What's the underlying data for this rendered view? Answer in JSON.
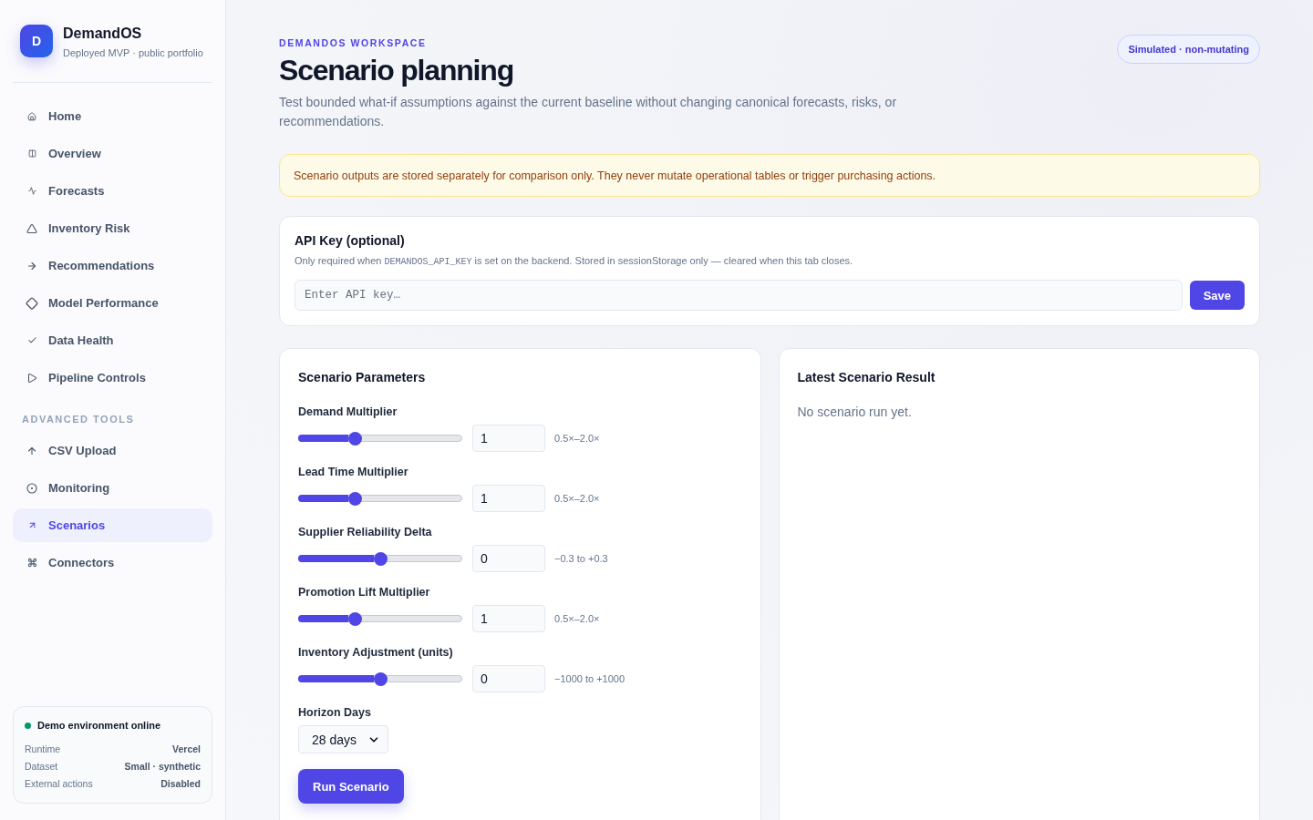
{
  "sidebar": {
    "brand": {
      "logo_letter": "D",
      "name": "DemandOS",
      "tagline": "Deployed MVP · public portfolio"
    },
    "nav_groups": [
      {
        "items": [
          {
            "label": "Home",
            "selected": false
          },
          {
            "label": "Overview",
            "selected": false
          },
          {
            "label": "Forecasts",
            "selected": false
          },
          {
            "label": "Inventory Risk",
            "selected": false
          },
          {
            "label": "Recommendations",
            "selected": false
          },
          {
            "label": "Model Performance",
            "selected": false
          },
          {
            "label": "Data Health",
            "selected": false
          },
          {
            "label": "Pipeline Controls",
            "selected": false
          }
        ]
      },
      {
        "heading": "ADVANCED TOOLS",
        "items": [
          {
            "label": "CSV Upload",
            "selected": false
          },
          {
            "label": "Monitoring",
            "selected": false
          },
          {
            "label": "Scenarios",
            "selected": true
          },
          {
            "label": "Connectors",
            "selected": false
          }
        ]
      }
    ],
    "status": {
      "title": "Demo environment online",
      "online": true,
      "rows": [
        {
          "label": "Runtime",
          "value": "Vercel"
        },
        {
          "label": "Dataset",
          "value": "Small · synthetic"
        },
        {
          "label": "External actions",
          "value": "Disabled"
        }
      ]
    }
  },
  "header": {
    "eyebrow": "DEMANDOS WORKSPACE",
    "title": "Scenario planning",
    "description": "Test bounded what-if assumptions against the current baseline without changing canonical forecasts, risks, or recommendations.",
    "badge": "Simulated · non-mutating"
  },
  "notice": "Scenario outputs are stored separately for comparison only. They never mutate operational tables or trigger purchasing actions.",
  "api_key": {
    "title": "API Key (optional)",
    "help": {
      "before": "Only required when ",
      "code": "DEMANDOS_API_KEY",
      "after": " is set on the backend. Stored in sessionStorage only — cleared when this tab closes."
    },
    "placeholder": "Enter API key…",
    "button": "Save"
  },
  "parameters": {
    "title": "Scenario Parameters",
    "sliders": [
      {
        "label": "Demand Multiplier",
        "level": 0.333,
        "value": "1",
        "range": "0.5×–2.0×"
      },
      {
        "label": "Lead Time Multiplier",
        "level": 0.333,
        "value": "1",
        "range": "0.5×–2.0×"
      },
      {
        "label": "Supplier Reliability Delta",
        "level": 0.5,
        "value": "0",
        "range": "−0.3 to +0.3"
      },
      {
        "label": "Promotion Lift Multiplier",
        "level": 0.333,
        "value": "1",
        "range": "0.5×–2.0×"
      },
      {
        "label": "Inventory Adjustment (units)",
        "level": 0.5,
        "value": "0",
        "range": "−1000 to +1000"
      }
    ],
    "horizon": {
      "label": "Horizon Days",
      "value": "28 days"
    },
    "button": "Run Scenario"
  },
  "result": {
    "title": "Latest Scenario Result",
    "message": "No scenario run yet."
  }
}
